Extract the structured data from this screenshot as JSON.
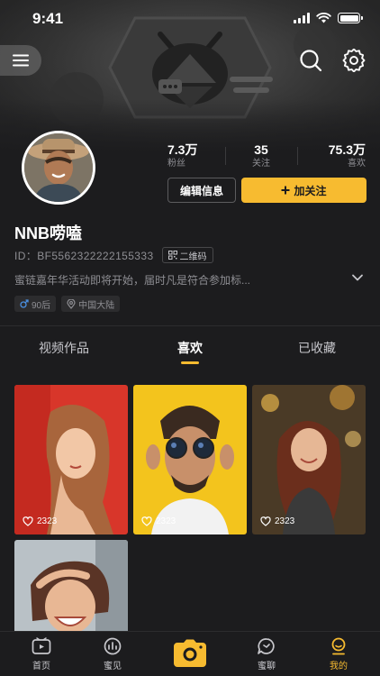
{
  "status_bar": {
    "time": "9:41"
  },
  "profile": {
    "username": "NNB唠嗑",
    "uid": "ID：BF5562322222155333",
    "qr_label": "二维码",
    "bio": "蜜链嘉年华活动即将开始，届时凡是符合参加标...",
    "tags": [
      {
        "icon": "male-icon",
        "label": "90后"
      },
      {
        "icon": "location-icon",
        "label": "中国大陆"
      }
    ],
    "stats": [
      {
        "value": "7.3万",
        "label": "粉丝"
      },
      {
        "value": "35",
        "label": "关注"
      },
      {
        "value": "75.3万",
        "label": "喜欢"
      }
    ],
    "edit_label": "编辑信息",
    "follow_label": "加关注"
  },
  "tabs": [
    {
      "label": "视频作品",
      "active": false
    },
    {
      "label": "喜欢",
      "active": true
    },
    {
      "label": "已收藏",
      "active": false
    }
  ],
  "videos": [
    {
      "likes": "2323"
    },
    {
      "likes": "2323"
    },
    {
      "likes": "2323"
    },
    {
      "likes": ""
    }
  ],
  "tabbar": [
    {
      "icon": "home-icon",
      "label": "首页",
      "active": false
    },
    {
      "icon": "discover-icon",
      "label": "蜜见",
      "active": false
    },
    {
      "icon": "camera-icon",
      "label": "",
      "active": false
    },
    {
      "icon": "chat-icon",
      "label": "蜜聊",
      "active": false
    },
    {
      "icon": "me-icon",
      "label": "我的",
      "active": true
    }
  ],
  "colors": {
    "accent": "#f7bb30",
    "background": "#1c1c1e",
    "muted": "#8e8e93"
  }
}
